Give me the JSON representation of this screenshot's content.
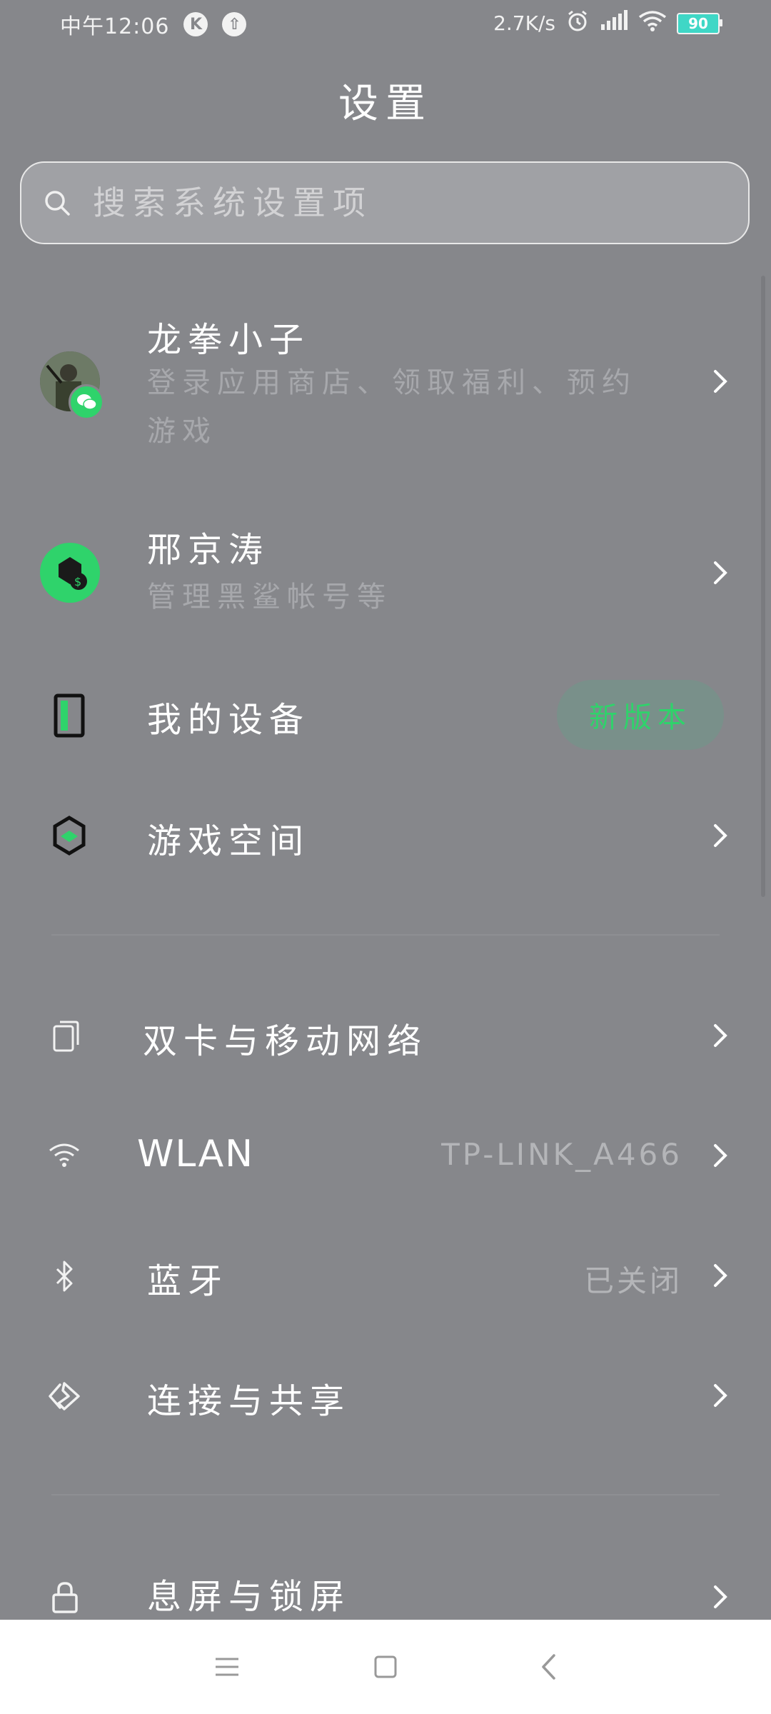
{
  "status_bar": {
    "time": "中午12:06",
    "app_badges": [
      "K",
      "⇧"
    ],
    "net_speed": "2.7K/s",
    "battery": "90",
    "icons": [
      "alarm-icon",
      "signal-icon",
      "wifi-icon",
      "battery-icon"
    ]
  },
  "page": {
    "title": "设置"
  },
  "search": {
    "placeholder": "搜索系统设置项"
  },
  "accounts": [
    {
      "title": "龙拳小子",
      "subtitle": "登录应用商店、领取福利、预约游戏"
    },
    {
      "title": "邢京涛",
      "subtitle": "管理黑鲨帐号等"
    }
  ],
  "device": {
    "title": "我的设备",
    "badge": "新版本"
  },
  "game_space": {
    "title": "游戏空间"
  },
  "network_items": [
    {
      "title": "双卡与移动网络",
      "value": ""
    },
    {
      "title": "WLAN",
      "value": "TP-LINK_A466"
    },
    {
      "title": "蓝牙",
      "value": "已关闭"
    },
    {
      "title": "连接与共享",
      "value": ""
    }
  ],
  "display_items": [
    {
      "title": "息屏与锁屏"
    }
  ],
  "colors": {
    "background": "#86878b",
    "accent_green": "#2fd36b",
    "badge_bg": "#79908a"
  }
}
